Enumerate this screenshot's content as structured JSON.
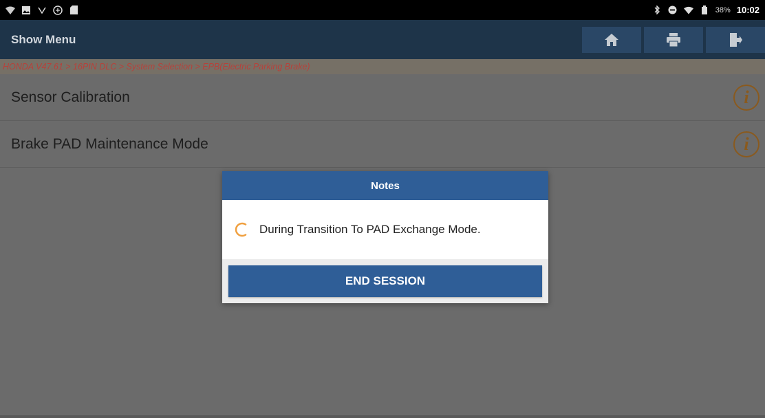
{
  "status_bar": {
    "left_icons": [
      "wifi-question-icon",
      "image-icon",
      "voicemail-icon",
      "circle-symbol-icon",
      "sd-card-icon"
    ],
    "right_icons": [
      "bluetooth-icon",
      "dnd-icon",
      "wifi-icon",
      "battery-icon"
    ],
    "battery": "38%",
    "time": "10:02"
  },
  "header": {
    "title": "Show Menu",
    "buttons": [
      "home-icon",
      "print-icon",
      "exit-icon"
    ]
  },
  "breadcrumb": "HONDA V47.61 > 16PIN DLC > System Selection > EPB(Electric Parking Brake)",
  "menu": {
    "items": [
      {
        "label": "Sensor Calibration",
        "info": "i"
      },
      {
        "label": "Brake PAD Maintenance Mode",
        "info": "i"
      }
    ]
  },
  "dialog": {
    "title": "Notes",
    "message": "During Transition To PAD Exchange Mode.",
    "button": "END SESSION"
  },
  "colors": {
    "header_bg": "#1e3449",
    "dialog_header": "#2f5e97",
    "spinner": "#f0a040",
    "breadcrumb_text": "#b8403a"
  }
}
